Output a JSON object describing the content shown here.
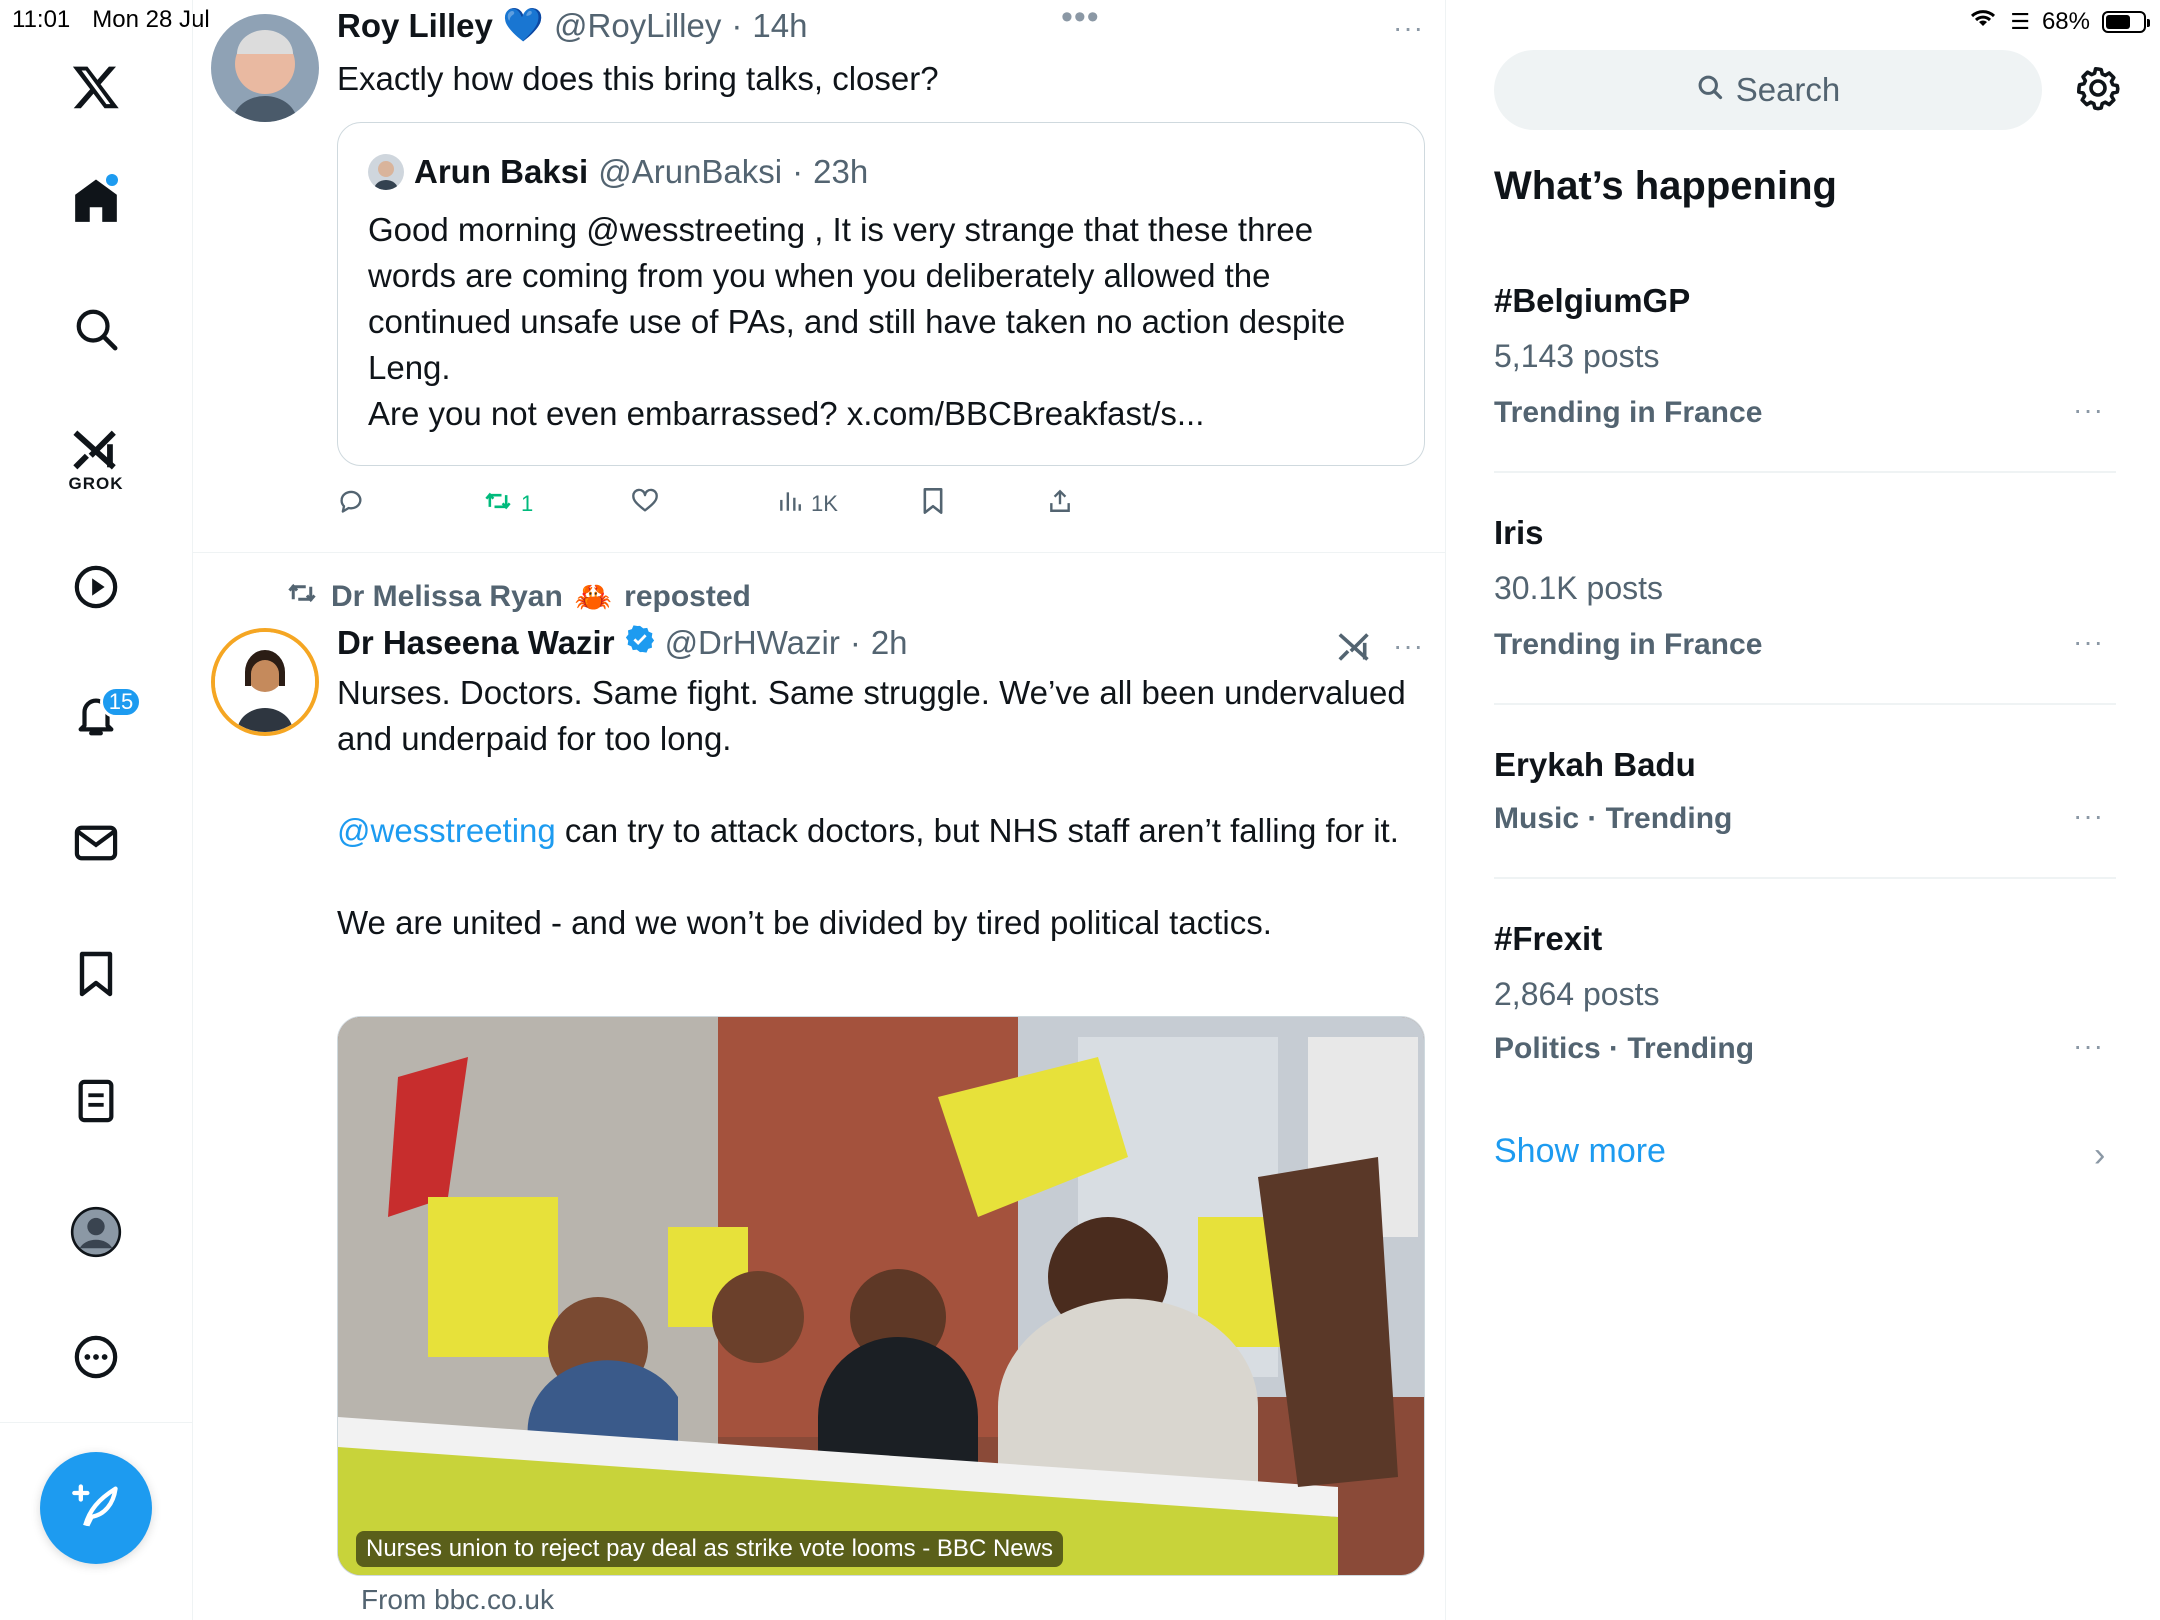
{
  "status_bar": {
    "time": "11:01",
    "date": "Mon 28 Jul",
    "battery": "68%",
    "battery_level": 0.68
  },
  "nav": {
    "logo": "x-logo-icon",
    "items": [
      {
        "name": "home",
        "icon": "home-icon"
      },
      {
        "name": "explore",
        "icon": "search-icon"
      },
      {
        "name": "grok",
        "icon": "grok-icon",
        "label": "GROK"
      },
      {
        "name": "videos",
        "icon": "play-icon"
      },
      {
        "name": "notifications",
        "icon": "bell-icon",
        "badge": "15"
      },
      {
        "name": "messages",
        "icon": "mail-icon"
      },
      {
        "name": "bookmarks",
        "icon": "bookmark-icon"
      },
      {
        "name": "lists",
        "icon": "list-icon"
      },
      {
        "name": "profile",
        "icon": "person-icon"
      },
      {
        "name": "more",
        "icon": "more-circle-icon"
      }
    ],
    "compose_icon": "compose-icon",
    "accent": "#1d9bf0"
  },
  "posts": [
    {
      "author": "Roy Lilley",
      "emoji": "💙",
      "handle": "@RoyLilley",
      "sep": "·",
      "time": "14h",
      "text": "Exactly how does this bring talks, closer?",
      "quote": {
        "author": "Arun Baksi",
        "handle": "@ArunBaksi",
        "sep": "·",
        "time": "23h",
        "text": "Good morning @wesstreeting , It is very strange that these three words are coming from you when you deliberately allowed the continued unsafe  use of PAs, and still have taken no action despite Leng.\nAre you not even embarrassed? x.com/BBCBreakfast/s..."
      },
      "actions": {
        "replies": "",
        "reposts": "1",
        "likes": "",
        "views": "1K"
      }
    },
    {
      "reposted_by": "Dr Melissa Ryan",
      "reposted_emoji": "🦀",
      "reposted_label": "reposted",
      "author": "Dr Haseena Wazir",
      "handle": "@DrHWazir",
      "sep": "·",
      "time": "2h",
      "text_line1": "Nurses. Doctors. Same fight. Same struggle. We’ve all been undervalued and underpaid for too long.",
      "mention": "@wesstreeting",
      "text_line2": " can try to attack doctors, but NHS staff aren’t falling for it.",
      "text_line3": "We are united - and we won’t be divided by tired political tactics.",
      "media_caption": "Nurses union to reject pay deal as strike vote looms - BBC News",
      "media_from": "From bbc.co.uk"
    }
  ],
  "right": {
    "search_placeholder": "Search",
    "section_title": "What’s happening",
    "trends": [
      {
        "name": "#BelgiumGP",
        "count": "5,143 posts",
        "context": "Trending in France"
      },
      {
        "name": "Iris",
        "count": "30.1K posts",
        "context": "Trending in France"
      },
      {
        "name": "Erykah Badu",
        "count": "",
        "context": "Music · Trending"
      },
      {
        "name": "#Frexit",
        "count": "2,864 posts",
        "context": "Politics · Trending"
      }
    ],
    "show_more": "Show more"
  }
}
